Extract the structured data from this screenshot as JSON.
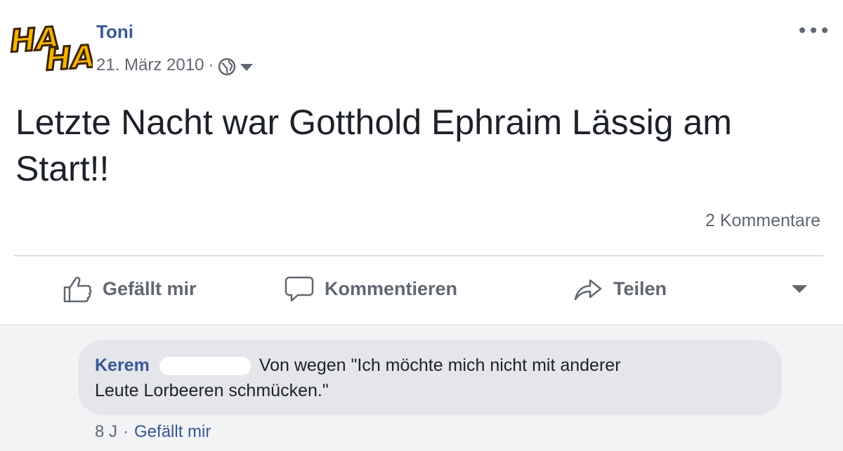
{
  "post": {
    "avatar_text": "HAHA",
    "author": "Toni",
    "date": "21. März 2010",
    "separator": "·",
    "privacy_icon": "globe-icon",
    "text": "Letzte Nacht war Gotthold Ephraim Lässig am Start!!",
    "comment_count": "2 Kommentare"
  },
  "actions": {
    "like_label": "Gefällt mir",
    "comment_label": "Kommentieren",
    "share_label": "Teilen",
    "like_icon": "thumbs-up-icon",
    "comment_icon": "speech-bubble-icon",
    "share_icon": "share-arrow-icon"
  },
  "comment": {
    "author": "Kerem",
    "text_line1": "Von wegen \"Ich möchte mich nicht mit anderer",
    "text_line2": "Leute Lorbeeren schmücken.\"",
    "age": "8 J",
    "separator": "·",
    "like_label": "Gefällt mir"
  },
  "colors": {
    "link": "#385898",
    "muted": "#616770",
    "bubble": "#e5e6ea",
    "comments_bg": "#f2f3f5"
  }
}
